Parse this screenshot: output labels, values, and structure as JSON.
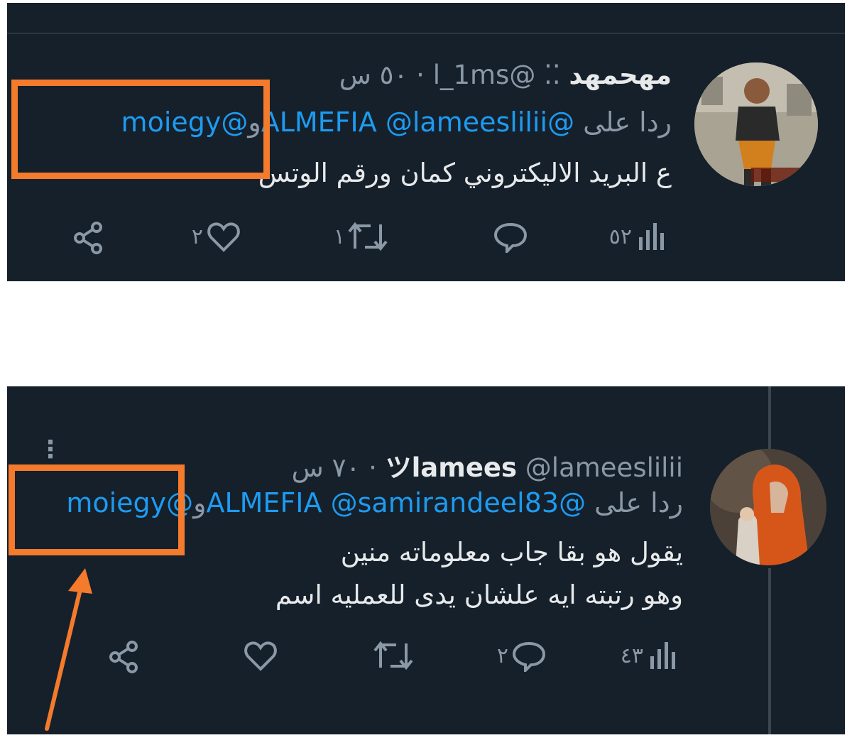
{
  "tweets": [
    {
      "author": {
        "display_name": "مهحمهد",
        "badge": "⁚⁚",
        "handle": "@l_1ms",
        "time": "٥٠ س"
      },
      "reply": {
        "prefix": "ردا على",
        "mention_1": "@ALMEFIA",
        "mention_2": "@lameeslilii",
        "joiner": "و",
        "mention_3": "@moiegy"
      },
      "body_lines": [
        "ع البريد الاليكتروني كمان ورقم الوتس"
      ],
      "stats": {
        "views": "٥٢",
        "replies": "",
        "retweets": "١",
        "likes": "٢"
      }
    },
    {
      "author": {
        "display_name": "lamees",
        "badge": "ツ",
        "handle": "@lameeslilii",
        "time": "٧٠ س"
      },
      "reply": {
        "prefix": "ردا على",
        "mention_1": "@ALMEFIA",
        "mention_2": "@samirandeel83",
        "joiner": "و",
        "mention_3": "@moiegy"
      },
      "body_lines": [
        "يقول هو بقا جاب معلوماته منين",
        "وهو رتبته ايه علشان يدى للعمليه اسم"
      ],
      "stats": {
        "views": "٤٣",
        "replies": "٢",
        "retweets": "",
        "likes": ""
      }
    }
  ],
  "icons": {
    "views": "analytics-icon",
    "reply": "comment-icon",
    "retweet": "retweet-icon",
    "like": "heart-icon",
    "share": "share-icon",
    "more": "more-vertical-icon"
  },
  "colors": {
    "background": "#15202b",
    "text": "#e7e9ea",
    "muted": "#8b98a5",
    "mention": "#1d9bf0",
    "highlight": "#f47a2c"
  }
}
